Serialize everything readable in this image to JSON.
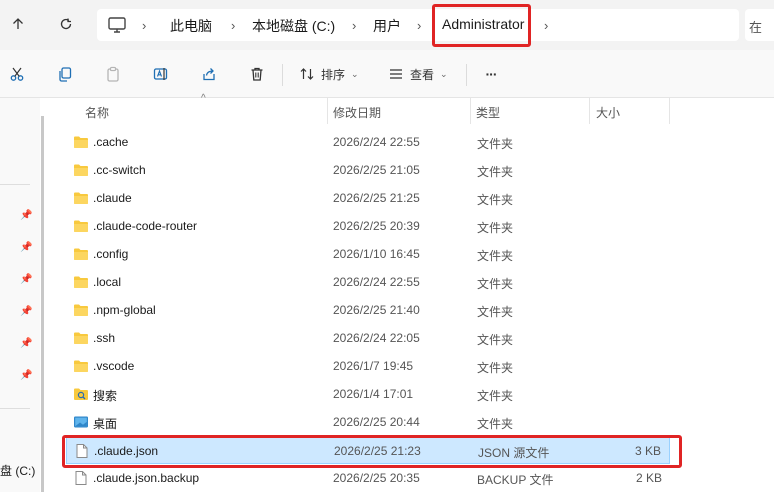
{
  "breadcrumb": [
    "此电脑",
    "本地磁盘 (C:)",
    "用户",
    "Administrator"
  ],
  "search": {
    "placeholder": "在"
  },
  "toolbar": {
    "sort_label": "排序",
    "view_label": "查看",
    "more_label": "···"
  },
  "columns": {
    "name": "名称",
    "date": "修改日期",
    "type": "类型",
    "size": "大小"
  },
  "leftpane": {
    "drive_label": "盘 (C:)"
  },
  "rows": [
    {
      "icon": "folder-icon",
      "name": ".cache",
      "date": "2026/2/24 22:55",
      "type": "文件夹",
      "size": ""
    },
    {
      "icon": "folder-icon",
      "name": ".cc-switch",
      "date": "2026/2/25 21:05",
      "type": "文件夹",
      "size": ""
    },
    {
      "icon": "folder-icon",
      "name": ".claude",
      "date": "2026/2/25 21:25",
      "type": "文件夹",
      "size": ""
    },
    {
      "icon": "folder-icon",
      "name": ".claude-code-router",
      "date": "2026/2/25 20:39",
      "type": "文件夹",
      "size": ""
    },
    {
      "icon": "folder-icon",
      "name": ".config",
      "date": "2026/1/10 16:45",
      "type": "文件夹",
      "size": ""
    },
    {
      "icon": "folder-icon",
      "name": ".local",
      "date": "2026/2/24 22:55",
      "type": "文件夹",
      "size": ""
    },
    {
      "icon": "folder-icon",
      "name": ".npm-global",
      "date": "2026/2/25 21:40",
      "type": "文件夹",
      "size": ""
    },
    {
      "icon": "folder-icon",
      "name": ".ssh",
      "date": "2026/2/24 22:05",
      "type": "文件夹",
      "size": ""
    },
    {
      "icon": "folder-icon",
      "name": ".vscode",
      "date": "2026/1/7 19:45",
      "type": "文件夹",
      "size": ""
    },
    {
      "icon": "search-folder-icon",
      "name": "搜索",
      "date": "2026/1/4 17:01",
      "type": "文件夹",
      "size": ""
    },
    {
      "icon": "desktop-folder-icon",
      "name": "桌面",
      "date": "2026/2/25 20:44",
      "type": "文件夹",
      "size": ""
    },
    {
      "icon": "file-icon",
      "name": ".claude.json",
      "date": "2026/2/25 21:23",
      "type": "JSON 源文件",
      "size": "3 KB"
    },
    {
      "icon": "file-icon",
      "name": ".claude.json.backup",
      "date": "2026/2/25 20:35",
      "type": "BACKUP 文件",
      "size": "2 KB"
    }
  ],
  "colors": {
    "highlight": "#e02424",
    "selection": "#cde8ff",
    "folder": "#f8c93e"
  }
}
